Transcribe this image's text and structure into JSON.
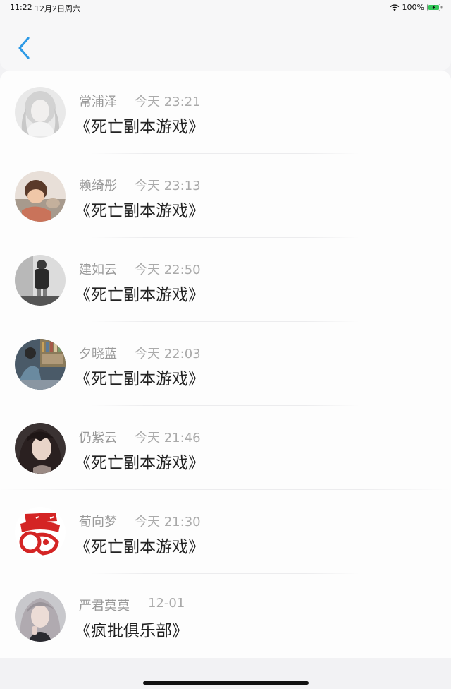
{
  "status_bar": {
    "time": "11:22",
    "date": "12月2日周六",
    "battery": "100%"
  },
  "nav": {
    "back_icon": "chevron-left-icon",
    "accent_color": "#2d9ae6"
  },
  "items": [
    {
      "name": "常浦泽",
      "time": "今天 23:21",
      "title": "《死亡副本游戏》",
      "avatar": "girl-sketch"
    },
    {
      "name": "赖绮彤",
      "time": "今天 23:13",
      "title": "《死亡副本游戏》",
      "avatar": "child-photo"
    },
    {
      "name": "建如云",
      "time": "今天 22:50",
      "title": "《死亡副本游戏》",
      "avatar": "man-mirror"
    },
    {
      "name": "夕晓蓝",
      "time": "今天 22:03",
      "title": "《死亡副本游戏》",
      "avatar": "boy-library"
    },
    {
      "name": "仍紫云",
      "time": "今天 21:46",
      "title": "《死亡副本游戏》",
      "avatar": "woman-portrait"
    },
    {
      "name": "荀向梦",
      "time": "今天 21:30",
      "title": "《死亡副本游戏》",
      "avatar": "red-papercut"
    },
    {
      "name": "严君莫莫",
      "time": "12-01",
      "title": "《疯批俱乐部》",
      "avatar": "woman-silver-hair"
    }
  ]
}
